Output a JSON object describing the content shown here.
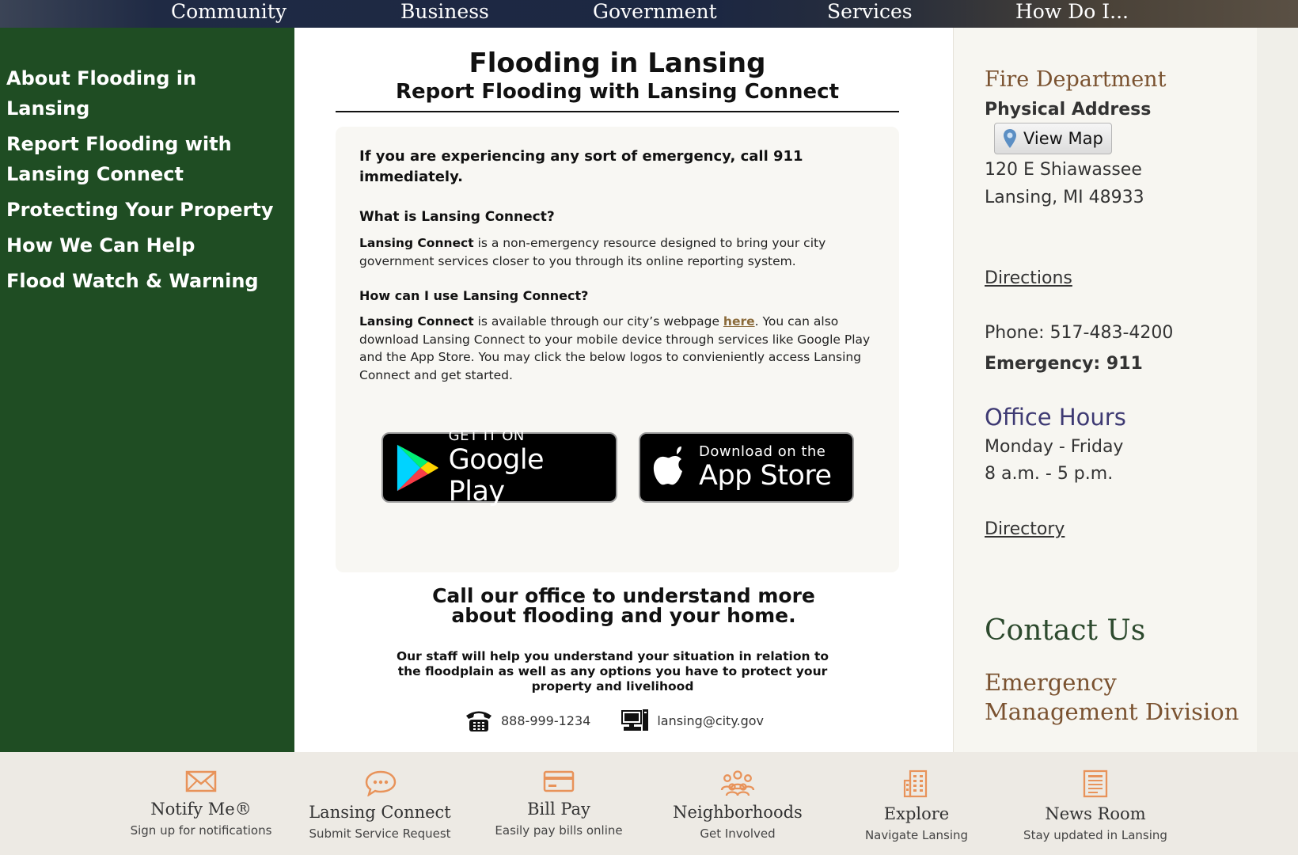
{
  "topnav": {
    "items": [
      "Community",
      "Business",
      "Government",
      "Services",
      "How Do I..."
    ]
  },
  "sidebar": {
    "items": [
      "About Flooding in Lansing",
      "Report Flooding with Lansing Connect",
      "Protecting Your Property",
      "How We Can Help",
      "Flood Watch & Warning"
    ]
  },
  "main": {
    "title": "Flooding in Lansing",
    "subtitle": "Report Flooding with Lansing Connect",
    "emergency_notice": "If you are experiencing any sort of emergency, call 911 immediately.",
    "q1": "What is Lansing Connect?",
    "a1_bold": "Lansing Connect",
    "a1_text": " is a non-emergency resource designed to bring your city government services closer to you through its online reporting system.",
    "q2": "How can I use Lansing Connect?",
    "a2_bold": "Lansing Connect",
    "a2_text_1": " is available through our city’s webpage ",
    "a2_link": "here",
    "a2_text_2": ". You can also download Lansing Connect to your mobile device through services like Google Play and the App Store. You may click the below logos to convieniently access Lansing Connect and get started.",
    "google_play_small": "GET IT ON",
    "google_play_big": "Google Play",
    "app_store_small": "Download on the",
    "app_store_big": "App Store",
    "call_heading_1": "Call our office to understand more",
    "call_heading_2": "about flooding and your home.",
    "call_sub": "Our staff will help you understand your situation in relation to the floodplain as well as any options you have to protect your property and livelihood",
    "phone": "888-999-1234",
    "email": "lansing@city.gov"
  },
  "right": {
    "dept_title": "Fire Department",
    "address_label": "Physical Address",
    "view_map": "View Map",
    "address_line1": "120 E Shiawassee",
    "address_line2": "Lansing, MI 48933",
    "directions": "Directions",
    "phone": "Phone: 517-483-4200",
    "emergency": "Emergency: 911",
    "office_hours_title": "Office Hours",
    "office_hours_days": "Monday - Friday",
    "office_hours_time": "8 a.m. - 5 p.m.",
    "directory": "Directory",
    "contact_title": "Contact Us",
    "division_title": "Emergency Management Division"
  },
  "footer": {
    "tiles": [
      {
        "title": "Notify Me®",
        "sub": "Sign up for notifications",
        "icon": "envelope-icon"
      },
      {
        "title": "Lansing Connect",
        "sub": "Submit Service Request",
        "icon": "chat-bubble-icon"
      },
      {
        "title": "Bill Pay",
        "sub": "Easily pay bills online",
        "icon": "credit-card-icon"
      },
      {
        "title": "Neighborhoods",
        "sub": "Get Involved",
        "icon": "people-group-icon"
      },
      {
        "title": "Explore",
        "sub": "Navigate Lansing",
        "icon": "building-icon"
      },
      {
        "title": "News Room",
        "sub": "Stay updated in Lansing",
        "icon": "newspaper-icon"
      }
    ]
  },
  "colors": {
    "sidebar_bg": "#1f4d23",
    "accent_brown": "#7a5230",
    "office_hours_purple": "#3e3a73",
    "footer_icon_orange": "#e8935a"
  }
}
